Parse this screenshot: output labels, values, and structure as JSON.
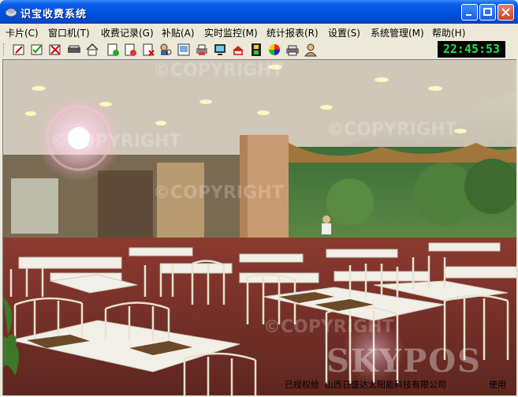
{
  "window": {
    "title": "识宝收费系统"
  },
  "menu": [
    {
      "label": "卡片(C)"
    },
    {
      "label": "窗口机(T)"
    },
    {
      "label": "收费记录(G)"
    },
    {
      "label": "补贴(A)"
    },
    {
      "label": "实时监控(M)"
    },
    {
      "label": "统计报表(R)"
    },
    {
      "label": "设置(S)"
    },
    {
      "label": "系统管理(M)"
    },
    {
      "label": "帮助(H)"
    }
  ],
  "toolbar": {
    "clock": "22:45:53",
    "icons": [
      "edit-card-icon",
      "check-card-icon",
      "cancel-card-icon",
      "card-reader-icon",
      "home-icon",
      "add-doc-icon",
      "export-doc-icon",
      "delete-doc-icon",
      "search-user-icon",
      "report-icon",
      "print-icon",
      "monitor-icon",
      "register-icon",
      "film-icon",
      "color-icon",
      "printer-icon",
      "user-icon"
    ]
  },
  "content": {
    "brand": "SKYPOS",
    "watermark": "©COPYRIGHT",
    "license_prefix": "已授权给",
    "licensee": "山西日盛达太阳能科技有限公司",
    "license_suffix": "使用"
  },
  "colors": {
    "titlebar": "#0054E3",
    "clock_text": "#22E14A",
    "menu_bg": "#ECE9D8"
  }
}
